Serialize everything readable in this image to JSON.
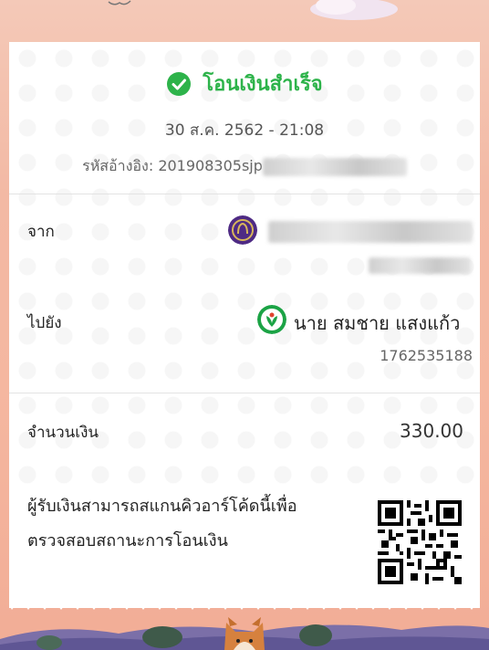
{
  "header": {
    "status_text": "โอนเงินสำเร็จ",
    "datetime": "30 ส.ค. 2562 - 21:08",
    "reference_label": "รหัสอ้างอิง: 201908305sjp"
  },
  "from": {
    "label": "จาก",
    "bank_icon": "scb-bank-icon"
  },
  "to": {
    "label": "ไปยัง",
    "name": "นาย สมชาย แสงแก้ว",
    "account": "1762535188",
    "bank_icon": "kbank-icon"
  },
  "amount": {
    "label": "จำนวนเงิน",
    "value": "330.00"
  },
  "note": {
    "line1": "ผู้รับเงินสามารถสแกนคิวอาร์โค้ดนี้เพื่อ",
    "line2": "ตรวจสอบสถานะการโอนเงิน"
  },
  "colors": {
    "success": "#2db34a",
    "scb_purple": "#4e2a84",
    "kbank_green": "#1ba345"
  }
}
